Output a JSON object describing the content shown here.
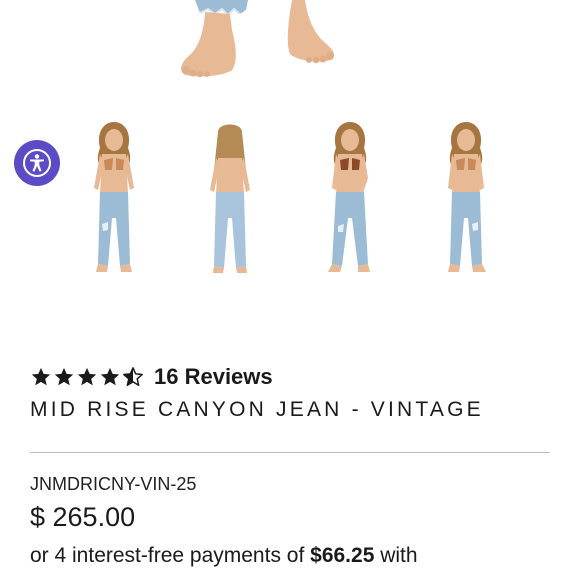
{
  "product": {
    "rating": {
      "value": 4.5,
      "max": 5,
      "reviews_label": "16 Reviews"
    },
    "title": "MID RISE CANYON JEAN - VINTAGE",
    "sku": "JNMDRICNY-VIN-25",
    "price": "$ 265.00",
    "installments": {
      "prefix": "or 4 interest-free payments of",
      "amount": "$66.25",
      "suffix": "with"
    }
  },
  "gallery": {
    "thumbnails": [
      {
        "view": "front"
      },
      {
        "view": "back"
      },
      {
        "view": "front-angle"
      },
      {
        "view": "side"
      }
    ]
  },
  "accessibility_widget": {
    "icon": "accessibility-icon",
    "color": "#5b4cc6"
  },
  "colors": {
    "skin": "#e7b995",
    "denim": "#9cbcd6",
    "text": "#1a1a1a",
    "divider": "#bdbdbd"
  }
}
